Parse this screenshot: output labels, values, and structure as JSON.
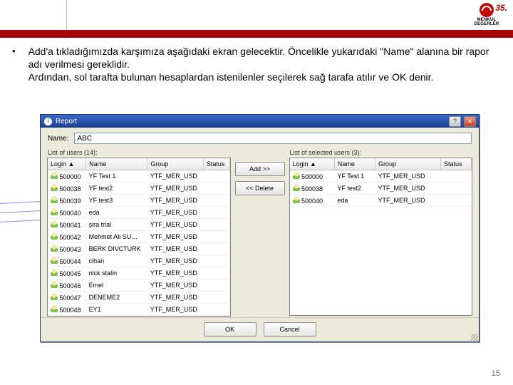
{
  "brand": {
    "number": "35.",
    "text": "MENKUL DEĞERLER"
  },
  "bullet": {
    "text": "Add'a tıkladığımızda karşımıza aşağıdaki ekran gelecektir. Öncelikle yukarıdaki \"Name\" alanına bir rapor adı verilmesi gereklidir.\nArdından, sol tarafta bulunan hesaplardan istenilenler seçilerek sağ tarafa atılır ve OK denir."
  },
  "page_number": "15",
  "dialog": {
    "title": "Report",
    "name_label": "Name:",
    "name_value": "ABC",
    "left_caption": "List of users (14):",
    "right_caption": "List of selected users (3):",
    "add_btn": "Add >>",
    "delete_btn": "<< Delete",
    "ok": "OK",
    "cancel": "Cancel",
    "columns": [
      "Login ▲",
      "Name",
      "Group",
      "Status"
    ],
    "left_rows": [
      {
        "login": "500000",
        "name": "YF Test 1",
        "group": "YTF_MER_USD",
        "status": ""
      },
      {
        "login": "500038",
        "name": "YF test2",
        "group": "YTF_MER_USD",
        "status": ""
      },
      {
        "login": "500039",
        "name": "YF test3",
        "group": "YTF_MER_USD",
        "status": ""
      },
      {
        "login": "500040",
        "name": "eda",
        "group": "YTF_MER_USD",
        "status": ""
      },
      {
        "login": "500041",
        "name": "şira trial",
        "group": "YTF_MER_USD",
        "status": ""
      },
      {
        "login": "500042",
        "name": "Mehmet Ali SU…",
        "group": "YTF_MER_USD",
        "status": ""
      },
      {
        "login": "500043",
        "name": "BERK DIVCTURK",
        "group": "YTF_MER_USD",
        "status": ""
      },
      {
        "login": "500044",
        "name": "cihan",
        "group": "YTF_MER_USD",
        "status": ""
      },
      {
        "login": "500045",
        "name": "nick stalin",
        "group": "YTF_MER_USD",
        "status": ""
      },
      {
        "login": "500046",
        "name": "Emel",
        "group": "YTF_MER_USD",
        "status": ""
      },
      {
        "login": "500047",
        "name": "DENEME2",
        "group": "YTF_MER_USD",
        "status": ""
      },
      {
        "login": "500048",
        "name": "EY1",
        "group": "YTF_MER_USD",
        "status": ""
      }
    ],
    "right_rows": [
      {
        "login": "500000",
        "name": "YF Test 1",
        "group": "YTF_MER_USD",
        "status": ""
      },
      {
        "login": "500038",
        "name": "YF test2",
        "group": "YTF_MER_USD",
        "status": ""
      },
      {
        "login": "500040",
        "name": "eda",
        "group": "YTF_MER_USD",
        "status": ""
      }
    ]
  }
}
